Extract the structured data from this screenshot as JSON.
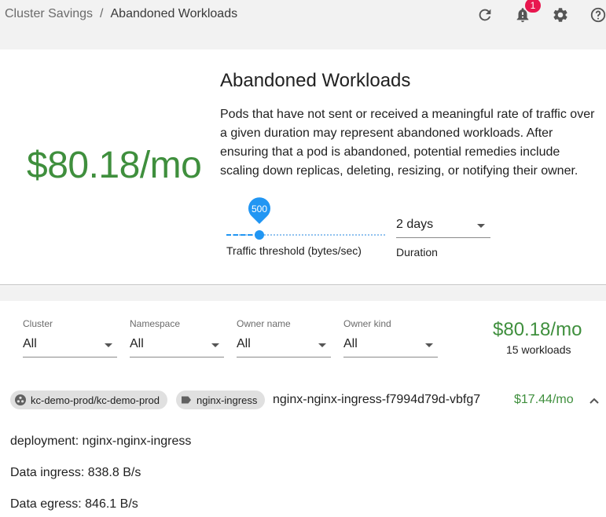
{
  "breadcrumb": {
    "parent": "Cluster Savings",
    "separator": "/",
    "current": "Abandoned Workloads"
  },
  "header": {
    "notifications_count": "1",
    "icons": [
      "refresh-icon",
      "bell-icon",
      "gear-icon",
      "help-icon"
    ]
  },
  "hero": {
    "amount": "$80.18/mo",
    "title": "Abandoned Workloads",
    "description": "Pods that have not sent or received a meaningful rate of traffic over a given duration may represent abandoned workloads. After ensuring that a pod is abandoned, potential remedies include scaling down replicas, deleting, resizing, or notifying their owner.",
    "slider": {
      "value": "500",
      "label": "Traffic threshold (bytes/sec)",
      "fraction": 0.2
    },
    "duration": {
      "value": "2 days",
      "label": "Duration"
    }
  },
  "filters": [
    {
      "label": "Cluster",
      "value": "All"
    },
    {
      "label": "Namespace",
      "value": "All"
    },
    {
      "label": "Owner name",
      "value": "All"
    },
    {
      "label": "Owner kind",
      "value": "All"
    }
  ],
  "summary": {
    "amount": "$80.18/mo",
    "count": "15 workloads"
  },
  "workload": {
    "cluster_chip": "kc-demo-prod/kc-demo-prod",
    "namespace_chip": "nginx-ingress",
    "pod_name": "nginx-nginx-ingress-f7994d79d-vbfg7",
    "cost": "$17.44/mo",
    "details": [
      "deployment: nginx-nginx-ingress",
      "Data ingress: 838.8 B/s",
      "Data egress: 846.1 B/s"
    ]
  },
  "colors": {
    "green": "#3f8f3d",
    "blue": "#2196f3",
    "badge": "#e8174f"
  }
}
